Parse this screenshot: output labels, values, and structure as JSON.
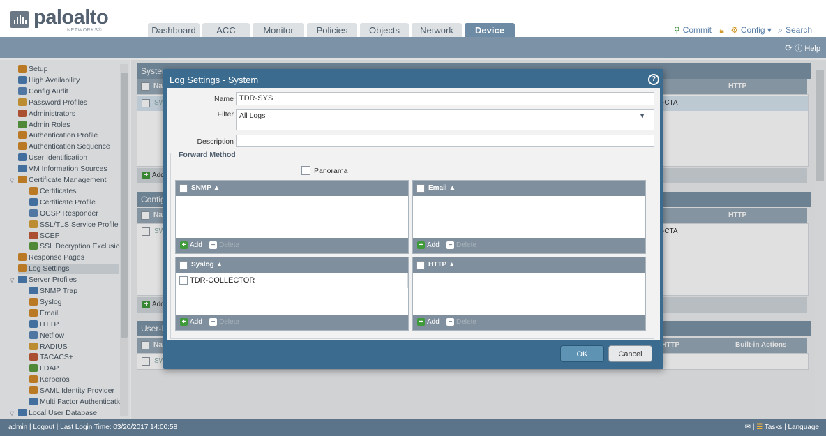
{
  "app": {
    "brand": "paloalto",
    "brand_sub": "NETWORKS®"
  },
  "tabs": [
    "Dashboard",
    "ACC",
    "Monitor",
    "Policies",
    "Objects",
    "Network",
    "Device"
  ],
  "toolbar": {
    "commit": "Commit",
    "config": "Config ▾",
    "search": "Search",
    "help": "Help"
  },
  "sidebar": {
    "items": [
      {
        "label": "Setup",
        "indent": 0
      },
      {
        "label": "High Availability",
        "indent": 0
      },
      {
        "label": "Config Audit",
        "indent": 0
      },
      {
        "label": "Password Profiles",
        "indent": 0
      },
      {
        "label": "Administrators",
        "indent": 0
      },
      {
        "label": "Admin Roles",
        "indent": 0
      },
      {
        "label": "Authentication Profile",
        "indent": 0
      },
      {
        "label": "Authentication Sequence",
        "indent": 0
      },
      {
        "label": "User Identification",
        "indent": 0
      },
      {
        "label": "VM Information Sources",
        "indent": 0
      },
      {
        "label": "Certificate Management",
        "indent": 0
      },
      {
        "label": "Certificates",
        "indent": 1
      },
      {
        "label": "Certificate Profile",
        "indent": 1
      },
      {
        "label": "OCSP Responder",
        "indent": 1
      },
      {
        "label": "SSL/TLS Service Profile",
        "indent": 1
      },
      {
        "label": "SCEP",
        "indent": 1
      },
      {
        "label": "SSL Decryption Exclusion",
        "indent": 1
      },
      {
        "label": "Response Pages",
        "indent": 0
      },
      {
        "label": "Log Settings",
        "indent": 0
      },
      {
        "label": "Server Profiles",
        "indent": 0
      },
      {
        "label": "SNMP Trap",
        "indent": 1
      },
      {
        "label": "Syslog",
        "indent": 1
      },
      {
        "label": "Email",
        "indent": 1
      },
      {
        "label": "HTTP",
        "indent": 1
      },
      {
        "label": "Netflow",
        "indent": 1
      },
      {
        "label": "RADIUS",
        "indent": 1
      },
      {
        "label": "TACACS+",
        "indent": 1
      },
      {
        "label": "LDAP",
        "indent": 1
      },
      {
        "label": "Kerberos",
        "indent": 1
      },
      {
        "label": "SAML Identity Provider",
        "indent": 1
      },
      {
        "label": "Multi Factor Authenticatio",
        "indent": 1
      },
      {
        "label": "Local User Database",
        "indent": 0
      }
    ]
  },
  "background": {
    "p1_title": "System",
    "p1_col": "Nar",
    "p1_row": "SW",
    "p1_cta": "-CTA",
    "p1_http": "HTTP",
    "p2_title": "Configu",
    "p2_col": "Nar",
    "p2_row": "SW",
    "p2_cta": "-CTA",
    "p2_http": "HTTP",
    "p3_title": "User-ID",
    "p3_col": "Nar",
    "p3_row": "SW",
    "p3_http": "HTTP",
    "p3_builtin": "Built-in Actions",
    "add": "Add"
  },
  "dialog": {
    "title": "Log Settings - System",
    "name_label": "Name",
    "name_value": "TDR-SYS",
    "filter_label": "Filter",
    "filter_value": "All Logs",
    "description_label": "Description",
    "description_value": "",
    "forward_method": "Forward Method",
    "panorama": "Panorama",
    "grids": {
      "snmp": {
        "header": "SNMP ▲",
        "rows": []
      },
      "email": {
        "header": "Email ▲",
        "rows": []
      },
      "syslog": {
        "header": "Syslog ▲",
        "rows": [
          "TDR-COLLECTOR"
        ]
      },
      "http": {
        "header": "HTTP ▲",
        "rows": []
      }
    },
    "add": "Add",
    "delete": "Delete",
    "ok": "OK",
    "cancel": "Cancel"
  },
  "status": {
    "user": "admin",
    "logout": "Logout",
    "last_login": "Last Login Time: 03/20/2017 14:00:58",
    "tasks": "Tasks",
    "language": "Language"
  }
}
